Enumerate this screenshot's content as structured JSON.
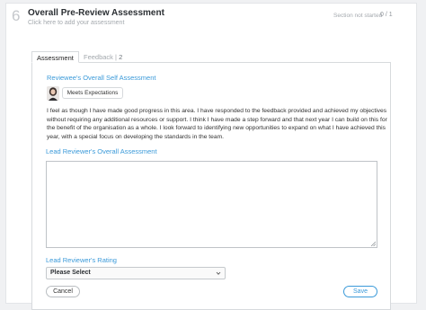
{
  "header": {
    "step_number": "6",
    "title": "Overall Pre-Review Assessment",
    "subtitle": "Click here to add your assessment",
    "status": "Section not started",
    "count": "0 / 1"
  },
  "tabs": [
    {
      "label": "Assessment"
    },
    {
      "label": "Feedback",
      "count": "2"
    }
  ],
  "self_assessment": {
    "label": "Reviewee's Overall Self Assessment",
    "rating": "Meets Expectations",
    "text": "I feel as though I have made good progress in this area. I have responded to the feedback provided and achieved my objectives without requiring any additional resources or support. I think I have made a step forward and that next year I can build on this for the benefit of the organisation as a whole. I look forward to identifying new opportunities to expand on what I have achieved this year, with a special focus on developing the standards in the team."
  },
  "lead_assessment": {
    "label": "Lead Reviewer's Overall Assessment",
    "value": ""
  },
  "lead_rating": {
    "label": "Lead Reviewer's Rating",
    "selected": "Please Select"
  },
  "actions": {
    "cancel_label": "Cancel",
    "save_label": "Save"
  },
  "colors": {
    "accent": "#3b9ad9",
    "background": "#f0f1f3"
  }
}
